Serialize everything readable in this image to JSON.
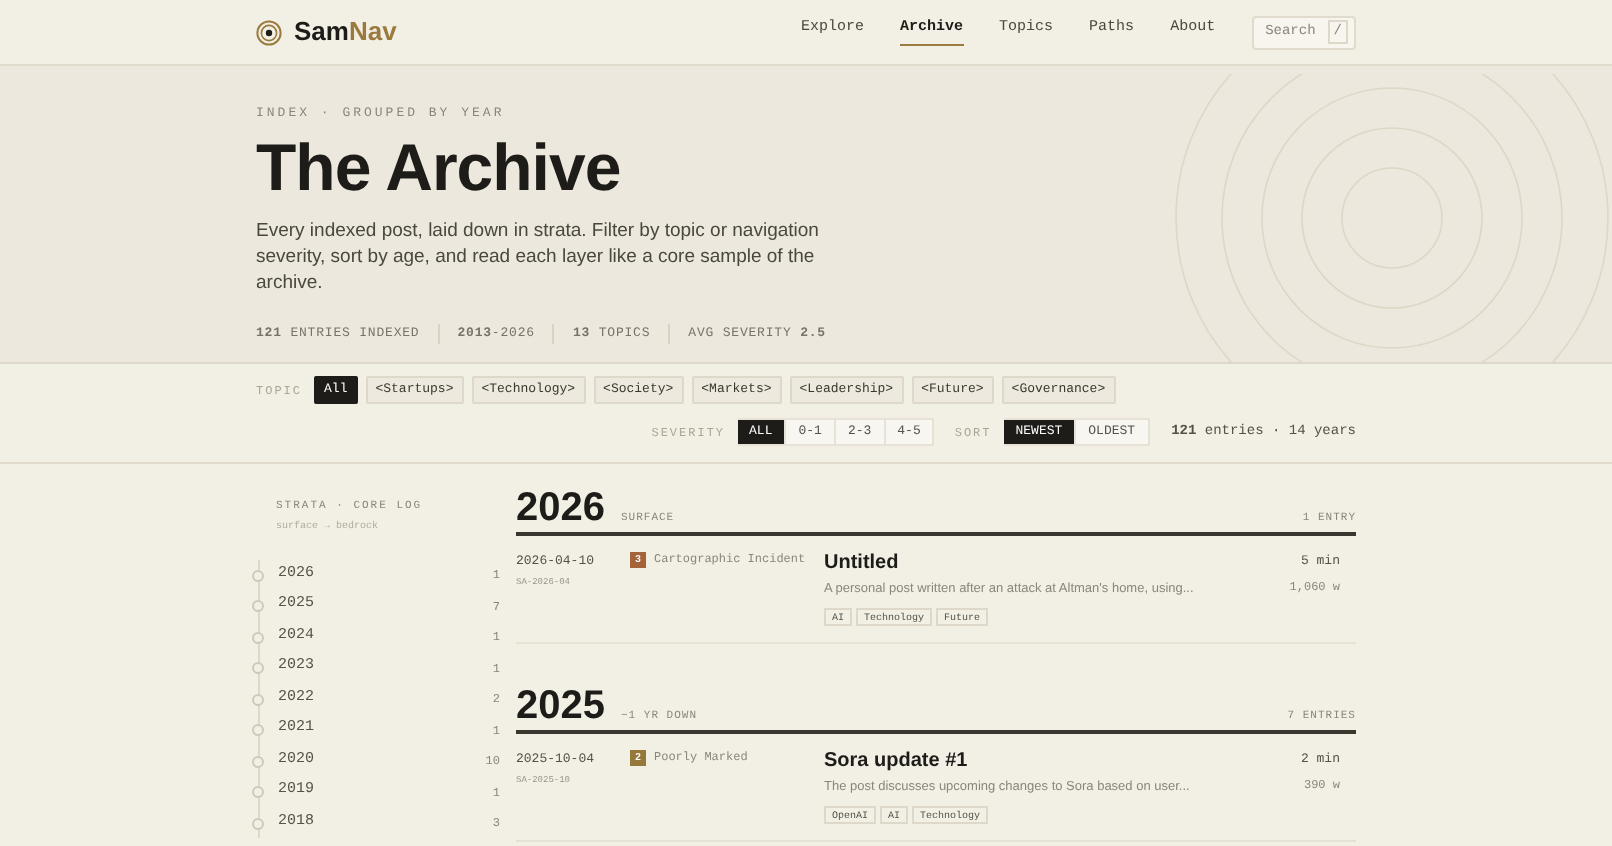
{
  "brand": {
    "name_part_1": "Sam",
    "name_part_2": "Nav"
  },
  "nav": [
    {
      "label": "Explore",
      "selected": false
    },
    {
      "label": "Archive",
      "selected": true
    },
    {
      "label": "Topics",
      "selected": false
    },
    {
      "label": "Paths",
      "selected": false
    },
    {
      "label": "About",
      "selected": false
    }
  ],
  "search": {
    "placeholder": "Search",
    "shortcut": "/"
  },
  "hero": {
    "eyebrow": "INDEX · GROUPED BY YEAR",
    "title": "The Archive",
    "description": "Every indexed post, laid down in strata. Filter by topic or navigation severity, sort by age, and read each layer like a core sample of the archive.",
    "stats": [
      "**121** ENTRIES INDEXED",
      "**2013**-2026",
      "**13** TOPICS",
      "AVG SEVERITY **2.5**"
    ]
  },
  "topic_filter": {
    "label": "TOPIC",
    "options": [
      {
        "label": "All",
        "selected": true
      },
      {
        "label": "<Startups>",
        "selected": false
      },
      {
        "label": "<Technology>",
        "selected": false
      },
      {
        "label": "<Society>",
        "selected": false
      },
      {
        "label": "<Markets>",
        "selected": false
      },
      {
        "label": "<Leadership>",
        "selected": false
      },
      {
        "label": "<Future>",
        "selected": false
      },
      {
        "label": "<Governance>",
        "selected": false
      }
    ]
  },
  "severity_filter": {
    "label": "SEVERITY",
    "options": [
      {
        "label": "ALL",
        "selected": true
      },
      {
        "label": "0-1",
        "selected": false
      },
      {
        "label": "2-3",
        "selected": false
      },
      {
        "label": "4-5",
        "selected": false
      }
    ]
  },
  "sort": {
    "label": "SORT",
    "options": [
      {
        "label": "NEWEST",
        "selected": true
      },
      {
        "label": "OLDEST",
        "selected": false
      }
    ]
  },
  "result_summary": "**121** entries · 14 years",
  "sidebar": {
    "title": "STRATA · CORE LOG",
    "subtitle": "surface → bedrock",
    "years": [
      {
        "year": "2026",
        "count": "1"
      },
      {
        "year": "2025",
        "count": "7"
      },
      {
        "year": "2024",
        "count": "1"
      },
      {
        "year": "2023",
        "count": "1"
      },
      {
        "year": "2022",
        "count": "2"
      },
      {
        "year": "2021",
        "count": "1"
      },
      {
        "year": "2020",
        "count": "10"
      },
      {
        "year": "2019",
        "count": "1"
      },
      {
        "year": "2018",
        "count": "3"
      }
    ]
  },
  "strata": [
    {
      "year": "2026",
      "depth": "SURFACE",
      "count": "1 ENTRY",
      "entries": [
        {
          "date": "2026-04-10",
          "code": "SA-2026-04",
          "severity": "3",
          "color": "#a5633a",
          "severity_label": "Cartographic Incident",
          "title": "Untitled",
          "summary": "A personal post written after an attack at Altman's home, using...",
          "tags": [
            "AI",
            "Technology",
            "Future"
          ],
          "read_time": "5 min",
          "words": "1,060 w"
        }
      ]
    },
    {
      "year": "2025",
      "depth": "−1 YR DOWN",
      "count": "7 ENTRIES",
      "entries": [
        {
          "date": "2025-10-04",
          "code": "SA-2025-10",
          "severity": "2",
          "color": "#94793a",
          "severity_label": "Poorly Marked",
          "title": "Sora update #1",
          "summary": "The post discusses upcoming changes to Sora based on user...",
          "tags": [
            "OpenAI",
            "AI",
            "Technology"
          ],
          "read_time": "2 min",
          "words": "390 w"
        }
      ]
    }
  ]
}
